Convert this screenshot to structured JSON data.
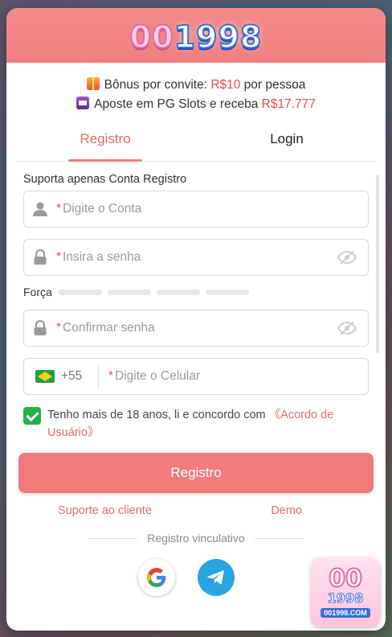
{
  "header": {
    "logo_text_oo": "00",
    "logo_text_num": "1998"
  },
  "promo": {
    "line1_prefix": "Bônus por convite: ",
    "line1_amount": "R$10",
    "line1_suffix": " por pessoa",
    "line2_prefix": "Aposte em PG Slots e receba ",
    "line2_amount": "R$17.777"
  },
  "tabs": [
    {
      "label": "Registro",
      "active": true
    },
    {
      "label": "Login",
      "active": false
    }
  ],
  "form": {
    "hint": "Suporta apenas Conta Registro",
    "account_placeholder": "Digite o Conta",
    "password_placeholder": "Insira a senha",
    "strength_label": "Força",
    "confirm_placeholder": "Confirmar senha",
    "phone_code": "+55",
    "phone_placeholder": "Digite o Celular",
    "agree_text": "Tenho mais de 18 anos, li e concordo com ",
    "agree_link": "《Acordo de Usuário》",
    "submit_label": "Registro"
  },
  "links": {
    "support": "Suporte ao cliente",
    "demo": "Demo"
  },
  "social": {
    "title": "Registro vinculativo"
  },
  "badge": {
    "big": "00",
    "num": "1998",
    "site": "001998.COM"
  },
  "colors": {
    "accent": "#f07b7b",
    "header": "#f08080",
    "link": "#e86a6a",
    "check": "#1fb44a",
    "telegram": "#2aa3e0"
  }
}
